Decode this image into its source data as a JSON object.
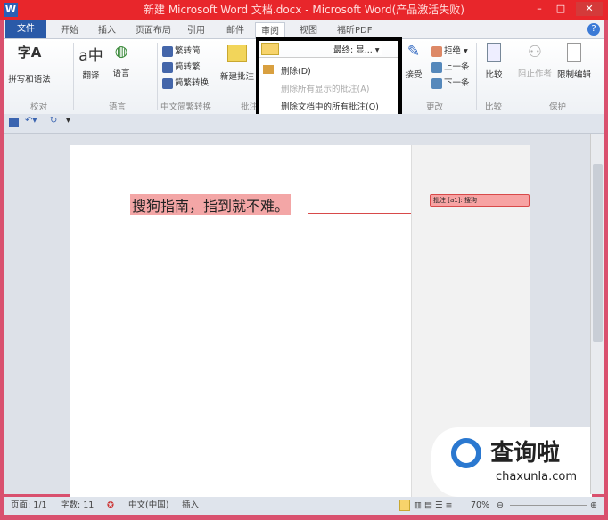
{
  "window": {
    "title": "新建 Microsoft Word 文档.docx - Microsoft Word(产品激活失败)",
    "app_icon": "W",
    "minimize": "–",
    "maximize": "□",
    "close": "✕"
  },
  "tabs": [
    {
      "label": "文件"
    },
    {
      "label": "开始"
    },
    {
      "label": "插入"
    },
    {
      "label": "页面布局"
    },
    {
      "label": "引用"
    },
    {
      "label": "邮件"
    },
    {
      "label": "审阅"
    },
    {
      "label": "视图"
    },
    {
      "label": "福昕PDF"
    }
  ],
  "ribbon": {
    "proofing": {
      "spell": "拼写和语法",
      "group": "校对"
    },
    "language": {
      "translate": "翻译",
      "language": "语言",
      "group": "语言"
    },
    "chinese": {
      "t2s": "繁转简",
      "s2t": "简转繁",
      "convert": "简繁转换",
      "group": "中文简繁转换"
    },
    "comments": {
      "new": "新建批注",
      "group": "批注"
    },
    "tracking": {
      "display": "最终: 显..."
    },
    "changes": {
      "accept": "接受",
      "reject": "拒绝",
      "prev": "上一条",
      "next": "下一条",
      "group": "更改"
    },
    "compare": {
      "compare": "比较",
      "group": "比较"
    },
    "protect": {
      "block": "阻止作者",
      "restrict": "限制编辑",
      "group": "保护"
    }
  },
  "delete_menu": {
    "items": [
      "删除(D)",
      "删除所有显示的批注(A)",
      "删除文档中的所有批注(O)"
    ]
  },
  "document": {
    "text": "搜狗指南，指到就不难。",
    "comment": "批注 [a1]: 搜狗"
  },
  "status": {
    "page": "页面: 1/1",
    "words": "字数: 11",
    "language": "中文(中国)",
    "mode": "插入",
    "zoom": "70%"
  },
  "watermark": {
    "brand": "查询啦",
    "url": "chaxunla.com"
  }
}
